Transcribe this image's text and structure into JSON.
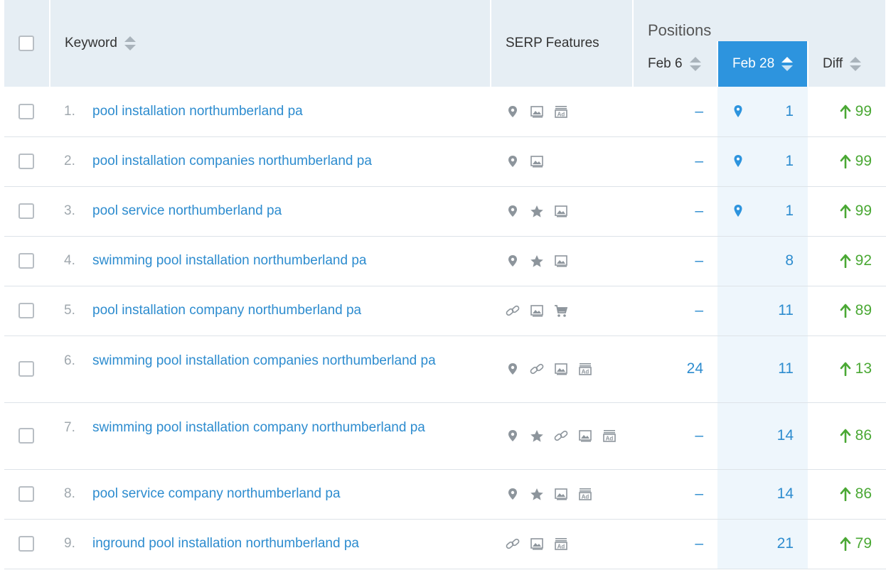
{
  "header": {
    "keyword_label": "Keyword",
    "serp_label": "SERP Features",
    "positions_label": "Positions",
    "feb6_label": "Feb 6",
    "feb28_label": "Feb 28",
    "diff_label": "Diff"
  },
  "colors": {
    "accent": "#2d94de",
    "link": "#2d8ccf",
    "up": "#4aa834",
    "header_bg": "#e6eef4"
  },
  "rows": [
    {
      "idx": "1.",
      "keyword": "pool installation northumberland pa",
      "features": [
        "map-pin-icon",
        "image-icon",
        "ad-icon"
      ],
      "feb6": "–",
      "feb28": "1",
      "feb28_pin": true,
      "diff": "99"
    },
    {
      "idx": "2.",
      "keyword": "pool installation companies northumberland pa",
      "features": [
        "map-pin-icon",
        "image-icon"
      ],
      "feb6": "–",
      "feb28": "1",
      "feb28_pin": true,
      "diff": "99"
    },
    {
      "idx": "3.",
      "keyword": "pool service northumberland pa",
      "features": [
        "map-pin-icon",
        "star-icon",
        "image-icon"
      ],
      "feb6": "–",
      "feb28": "1",
      "feb28_pin": true,
      "diff": "99"
    },
    {
      "idx": "4.",
      "keyword": "swimming pool installation northumberland pa",
      "features": [
        "map-pin-icon",
        "star-icon",
        "image-icon"
      ],
      "feb6": "–",
      "feb28": "8",
      "feb28_pin": false,
      "diff": "92"
    },
    {
      "idx": "5.",
      "keyword": "pool installation company northumberland pa",
      "features": [
        "link-icon",
        "image-icon",
        "cart-icon"
      ],
      "feb6": "–",
      "feb28": "11",
      "feb28_pin": false,
      "diff": "89"
    },
    {
      "idx": "6.",
      "keyword": "swimming pool installation companies northumberland pa",
      "features": [
        "map-pin-icon",
        "link-icon",
        "image-icon",
        "ad-icon"
      ],
      "feb6": "24",
      "feb28": "11",
      "feb28_pin": false,
      "diff": "13",
      "tall": true
    },
    {
      "idx": "7.",
      "keyword": "swimming pool installation company northumberland pa",
      "features": [
        "map-pin-icon",
        "star-icon",
        "link-icon",
        "image-icon",
        "ad-icon"
      ],
      "feb6": "–",
      "feb28": "14",
      "feb28_pin": false,
      "diff": "86",
      "tall": true
    },
    {
      "idx": "8.",
      "keyword": "pool service company northumberland pa",
      "features": [
        "map-pin-icon",
        "star-icon",
        "image-icon",
        "ad-icon"
      ],
      "feb6": "–",
      "feb28": "14",
      "feb28_pin": false,
      "diff": "86"
    },
    {
      "idx": "9.",
      "keyword": "inground pool installation northumberland pa",
      "features": [
        "link-icon",
        "image-icon",
        "ad-icon"
      ],
      "feb6": "–",
      "feb28": "21",
      "feb28_pin": false,
      "diff": "79"
    }
  ]
}
